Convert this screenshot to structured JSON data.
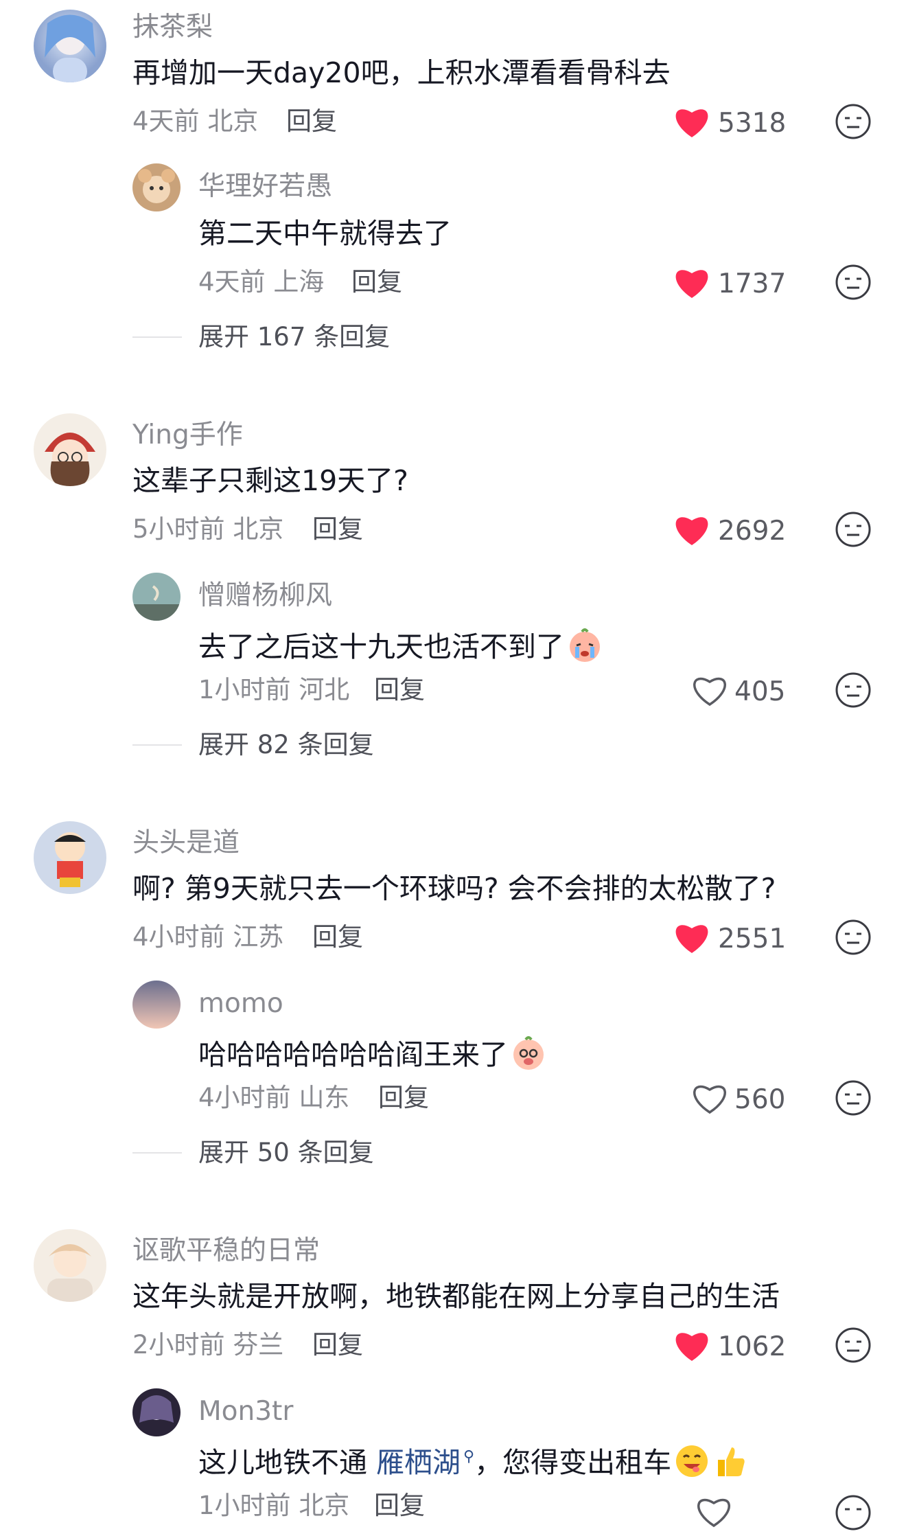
{
  "comments": [
    {
      "user": "抹茶梨",
      "text": "再增加一天day20吧，上积水潭看看骨科去",
      "time": "4天前",
      "location": "北京",
      "reply": "回复",
      "likes": "5318",
      "liked": true,
      "sub_reply": {
        "user": "华理好若愚",
        "text": "第二天中午就得去了",
        "time": "4天前",
        "location": "上海",
        "reply": "回复",
        "likes": "1737",
        "liked": true
      },
      "expand": "展开 167 条回复"
    },
    {
      "user": "Ying手作",
      "text": "这辈子只剩这19天了?",
      "time": "5小时前",
      "location": "北京",
      "reply": "回复",
      "likes": "2692",
      "liked": true,
      "sub_reply": {
        "user": "憎赠杨柳风",
        "text": "去了之后这十九天也活不到了",
        "time": "1小时前",
        "location": "河北",
        "reply": "回复",
        "likes": "405",
        "liked": false
      },
      "expand": "展开 82 条回复"
    },
    {
      "user": "头头是道",
      "text": "啊? 第9天就只去一个环球吗? 会不会排的太松散了?",
      "time": "4小时前",
      "location": "江苏",
      "reply": "回复",
      "likes": "2551",
      "liked": true,
      "sub_reply": {
        "user": "momo",
        "text": "哈哈哈哈哈哈哈阎王来了",
        "time": "4小时前",
        "location": "山东",
        "reply": "回复",
        "likes": "560",
        "liked": false
      },
      "expand": "展开 50 条回复"
    },
    {
      "user": "讴歌平稳的日常",
      "text": "这年头就是开放啊，地铁都能在网上分享自己的生活",
      "time": "2小时前",
      "location": "芬兰",
      "reply": "回复",
      "likes": "1062",
      "liked": true,
      "sub_reply": {
        "user": "Mon3tr",
        "text_before": "这儿地铁不通 ",
        "link": "雁栖湖",
        "text_after": "，您得变出租车",
        "time": "1小时前",
        "location": "北京",
        "reply": "回复"
      }
    }
  ],
  "colors": {
    "heart_red": "#fe2c55",
    "secondary_text": "#8a8b91",
    "link": "#2d4f8c"
  },
  "icons": [
    "heart-icon",
    "heart-outline-icon",
    "dislike-face-icon",
    "search-icon",
    "grin-emoji",
    "thumbs-up-emoji",
    "crying-emoji",
    "peach-emoji"
  ]
}
